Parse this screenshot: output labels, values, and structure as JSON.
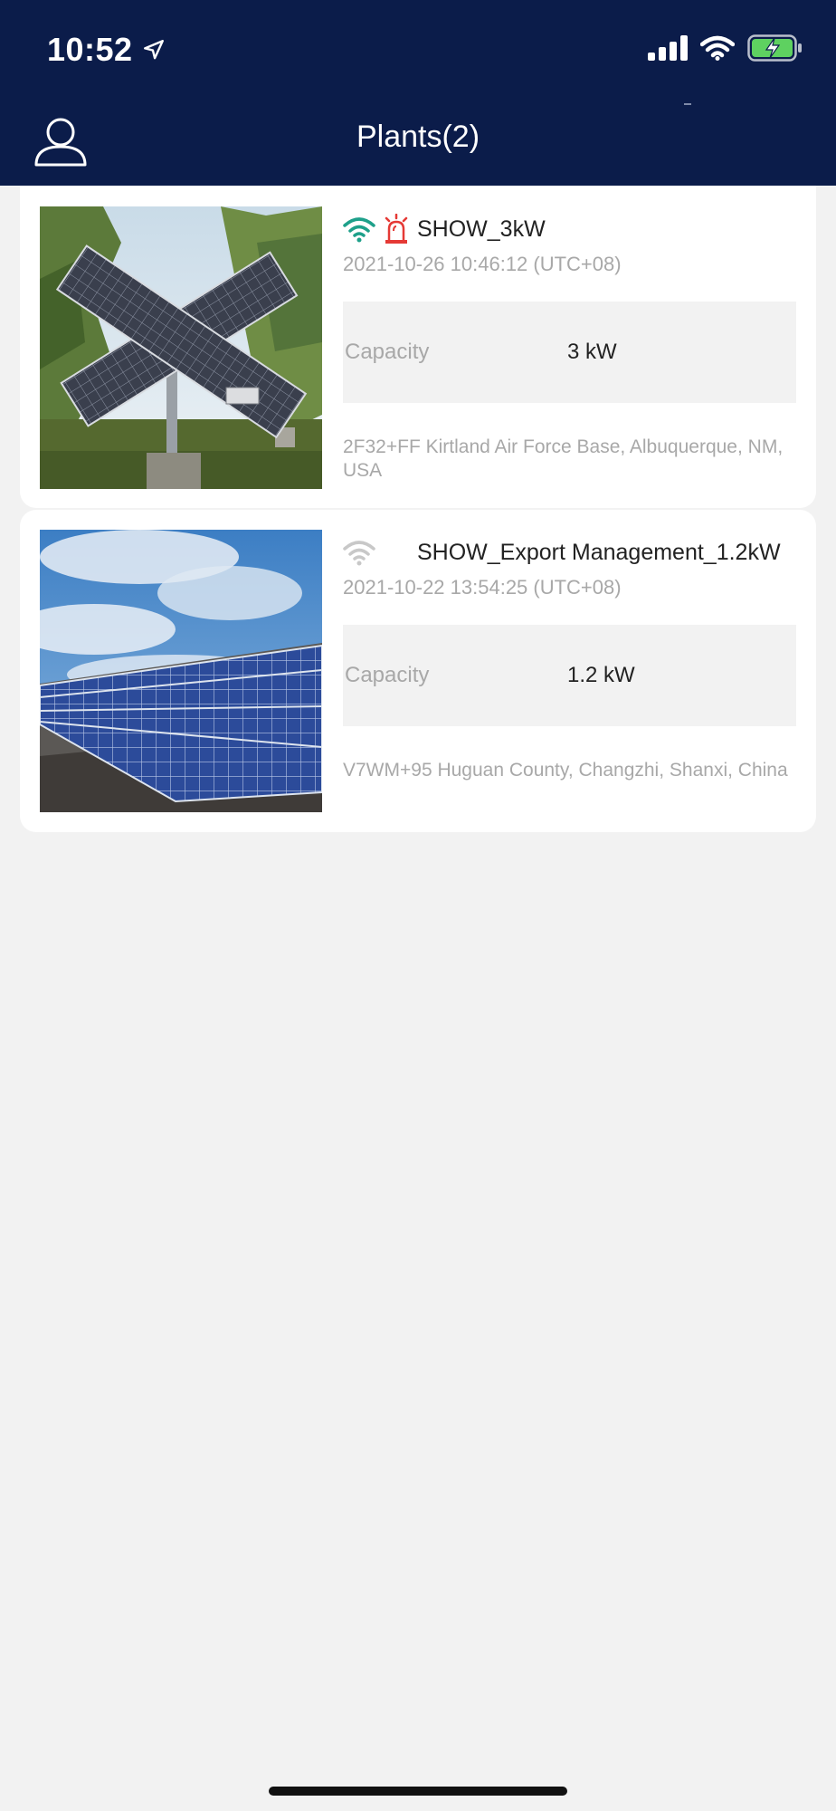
{
  "status_bar": {
    "time": "10:52",
    "icons": [
      "location-arrow-icon",
      "cellular-signal-icon",
      "wifi-icon",
      "battery-charging-icon"
    ]
  },
  "header": {
    "title": "Plants(2)",
    "user_icon": "user-icon"
  },
  "plants": [
    {
      "name": "SHOW_3kW",
      "timestamp": "2021-10-26 10:46:12 (UTC+08)",
      "capacity_label": "Capacity",
      "capacity_value": "3 kW",
      "address": "2F32+FF Kirtland Air Force Base, Albuquerque, NM, USA",
      "online": true,
      "alarm": true,
      "image": "solar-tracker-photo"
    },
    {
      "name": "SHOW_Export Management_1.2kW",
      "timestamp": "2021-10-22 13:54:25 (UTC+08)",
      "capacity_label": "Capacity",
      "capacity_value": "1.2 kW",
      "address": "V7WM+95 Huguan County, Changzhi, Shanxi, China",
      "online": false,
      "alarm": false,
      "image": "solar-array-photo"
    }
  ],
  "colors": {
    "header_bg": "#0b1c4a",
    "online": "#1ea08a",
    "offline": "#c8c8c8",
    "alarm": "#e53935",
    "battery": "#5ed160"
  }
}
